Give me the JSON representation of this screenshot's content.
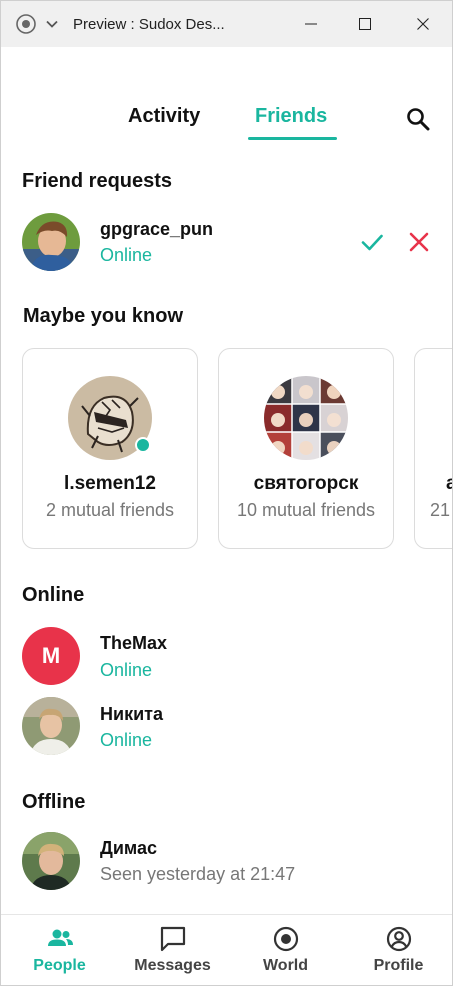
{
  "window": {
    "title": "Preview : Sudox Des..."
  },
  "tabs": {
    "activity": "Activity",
    "friends": "Friends"
  },
  "friend_requests": {
    "heading": "Friend requests",
    "items": [
      {
        "name": "gpgrace_pun",
        "status": "Online"
      }
    ]
  },
  "maybe_you_know": {
    "heading": "Maybe you know",
    "cards": [
      {
        "name": "l.semen12",
        "mutual": "2 mutual friends",
        "online": true
      },
      {
        "name": "святогорск",
        "mutual": "10 mutual friends",
        "online": false
      },
      {
        "name": "a",
        "mutual": "21",
        "online": false
      }
    ]
  },
  "online": {
    "heading": "Online",
    "items": [
      {
        "name": "TheMax",
        "status": "Online",
        "initial": "M"
      },
      {
        "name": "Никита",
        "status": "Online"
      }
    ]
  },
  "offline": {
    "heading": "Offline",
    "items": [
      {
        "name": "Димас",
        "status": "Seen yesterday at 21:47"
      }
    ]
  },
  "bottom_nav": {
    "items": [
      {
        "label": "People",
        "icon": "people-icon",
        "active": true
      },
      {
        "label": "Messages",
        "icon": "message-icon",
        "active": false
      },
      {
        "label": "World",
        "icon": "world-icon",
        "active": false
      },
      {
        "label": "Profile",
        "icon": "profile-icon",
        "active": false
      }
    ]
  },
  "colors": {
    "accent": "#1ab69f",
    "decline": "#e8334a",
    "avatar_red": "#e8334a",
    "muted_text": "#777777"
  }
}
